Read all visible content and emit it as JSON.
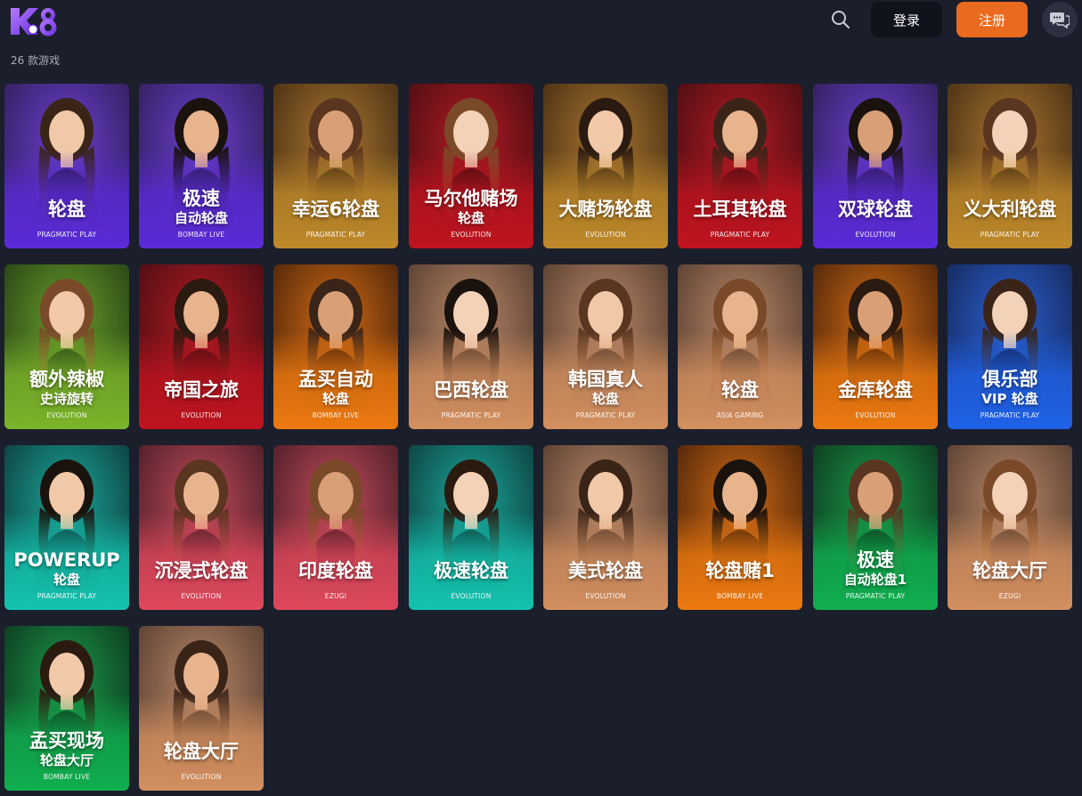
{
  "header": {
    "logo_text": "K8",
    "login_label": "登录",
    "register_label": "注册",
    "colors": {
      "register": "#ea6a1f",
      "login": "#10131c",
      "background": "#1b1e2b"
    }
  },
  "results": {
    "count_text": "26 款游戏"
  },
  "games": [
    {
      "title": "轮盘",
      "subtitle": "",
      "provider": "PRAGMATIC PLAY",
      "theme": "purple"
    },
    {
      "title": "极速",
      "subtitle": "自动轮盘",
      "provider": "BOMBAY LIVE",
      "theme": "purple"
    },
    {
      "title": "幸运6轮盘",
      "subtitle": "",
      "provider": "PRAGMATIC PLAY",
      "theme": "gold"
    },
    {
      "title": "马尔他赌场",
      "subtitle": "轮盘",
      "provider": "EVOLUTION",
      "theme": "red"
    },
    {
      "title": "大赌场轮盘",
      "subtitle": "",
      "provider": "EVOLUTION",
      "theme": "gold"
    },
    {
      "title": "土耳其轮盘",
      "subtitle": "",
      "provider": "PRAGMATIC PLAY",
      "theme": "red"
    },
    {
      "title": "双球轮盘",
      "subtitle": "",
      "provider": "EVOLUTION",
      "theme": "purple"
    },
    {
      "title": "义大利轮盘",
      "subtitle": "",
      "provider": "PRAGMATIC PLAY",
      "theme": "gold"
    },
    {
      "title": "额外辣椒",
      "subtitle": "史诗旋转",
      "provider": "EVOLUTION",
      "theme": "lime"
    },
    {
      "title": "帝国之旅",
      "subtitle": "",
      "provider": "EVOLUTION",
      "theme": "red"
    },
    {
      "title": "孟买自动",
      "subtitle": "轮盘",
      "provider": "BOMBAY LIVE",
      "theme": "orange"
    },
    {
      "title": "巴西轮盘",
      "subtitle": "",
      "provider": "PRAGMATIC PLAY",
      "theme": "peach"
    },
    {
      "title": "韩国真人",
      "subtitle": "轮盘",
      "provider": "PRAGMATIC PLAY",
      "theme": "peach"
    },
    {
      "title": "轮盘",
      "subtitle": "",
      "provider": "ASIA GAMING",
      "theme": "peach"
    },
    {
      "title": "金库轮盘",
      "subtitle": "",
      "provider": "EVOLUTION",
      "theme": "orange"
    },
    {
      "title": "俱乐部",
      "subtitle": "VIP 轮盘",
      "provider": "PRAGMATIC PLAY",
      "theme": "blue"
    },
    {
      "title": "POWERUP",
      "subtitle": "轮盘",
      "provider": "PRAGMATIC PLAY",
      "theme": "teal"
    },
    {
      "title": "沉浸式轮盘",
      "subtitle": "",
      "provider": "EVOLUTION",
      "theme": "pink"
    },
    {
      "title": "印度轮盘",
      "subtitle": "",
      "provider": "EZUGI",
      "theme": "pink"
    },
    {
      "title": "极速轮盘",
      "subtitle": "",
      "provider": "EVOLUTION",
      "theme": "teal"
    },
    {
      "title": "美式轮盘",
      "subtitle": "",
      "provider": "EVOLUTION",
      "theme": "peach"
    },
    {
      "title": "轮盘赌1",
      "subtitle": "",
      "provider": "BOMBAY LIVE",
      "theme": "orange"
    },
    {
      "title": "极速",
      "subtitle": "自动轮盘1",
      "provider": "PRAGMATIC PLAY",
      "theme": "green"
    },
    {
      "title": "轮盘大厅",
      "subtitle": "",
      "provider": "EZUGI",
      "theme": "peach"
    },
    {
      "title": "孟买现场",
      "subtitle": "轮盘大厅",
      "provider": "BOMBAY LIVE",
      "theme": "green"
    },
    {
      "title": "轮盘大厅",
      "subtitle": "",
      "provider": "EVOLUTION",
      "theme": "peach"
    }
  ],
  "themes": {
    "purple": {
      "bg": "#2a1a4a",
      "glow": "#6a3fd0",
      "band": "#5a2bd8"
    },
    "gold": {
      "bg": "#3a2410",
      "glow": "#a8752f",
      "band": "#c08a2a"
    },
    "red": {
      "bg": "#3a0c10",
      "glow": "#b41a24",
      "band": "#c0141f"
    },
    "lime": {
      "bg": "#1d3412",
      "glow": "#6a9e2a",
      "band": "#7cb52a"
    },
    "orange": {
      "bg": "#3a1a08",
      "glow": "#d06a14",
      "band": "#ee7a10"
    },
    "peach": {
      "bg": "#4a3428",
      "glow": "#b88768",
      "band": "#d49060"
    },
    "blue": {
      "bg": "#12204a",
      "glow": "#2a60d0",
      "band": "#1f62e8"
    },
    "teal": {
      "bg": "#0c2e30",
      "glow": "#1aa89a",
      "band": "#14c4b0"
    },
    "pink": {
      "bg": "#3a1820",
      "glow": "#c24a5a",
      "band": "#e0485c"
    },
    "green": {
      "bg": "#0c2a18",
      "glow": "#1a9a4a",
      "band": "#10b050"
    }
  }
}
